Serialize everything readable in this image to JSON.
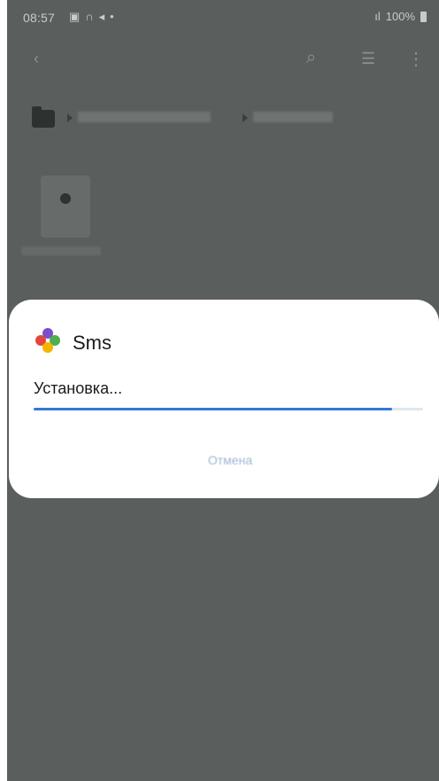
{
  "status_bar": {
    "time": "08:57",
    "left_icons": [
      "image-icon",
      "headset-icon",
      "send-icon",
      "dot-icon"
    ],
    "network": "ıl",
    "battery_percent": "100%"
  },
  "toolbar": {
    "back_icon": "back-arrow-icon",
    "search_icon": "search-icon",
    "list_icon": "list-view-icon",
    "more_icon": "more-vert-icon"
  },
  "background": {
    "path_separator": "▸"
  },
  "dialog": {
    "app_name": "Sms",
    "status": "Установка...",
    "progress": 0.92,
    "cancel_label": "Отмена"
  },
  "colors": {
    "overlay": "#5a5e5d",
    "dialog_bg": "#ffffff",
    "progress": "#3478d8",
    "progress_track": "#dfe6ee",
    "cancel_text": "#9fb7d2"
  }
}
